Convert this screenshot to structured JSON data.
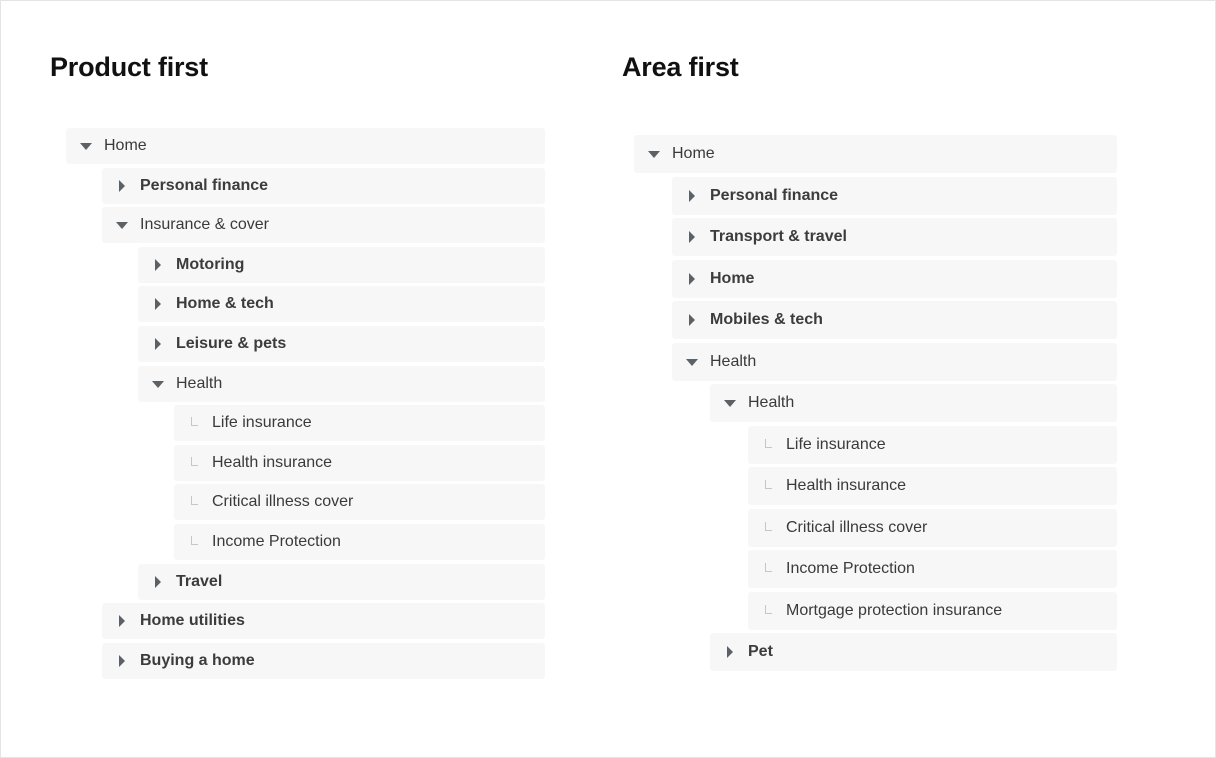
{
  "panels": [
    {
      "title": "Product first",
      "rows": [
        {
          "label": "Home",
          "level": 0,
          "state": "expanded",
          "bold": false
        },
        {
          "label": "Personal finance",
          "level": 1,
          "state": "collapsed",
          "bold": true
        },
        {
          "label": "Insurance & cover",
          "level": 1,
          "state": "expanded",
          "bold": false
        },
        {
          "label": "Motoring",
          "level": 2,
          "state": "collapsed",
          "bold": true
        },
        {
          "label": "Home & tech",
          "level": 2,
          "state": "collapsed",
          "bold": true
        },
        {
          "label": "Leisure & pets",
          "level": 2,
          "state": "collapsed",
          "bold": true
        },
        {
          "label": "Health",
          "level": 2,
          "state": "expanded",
          "bold": false
        },
        {
          "label": "Life insurance",
          "level": 3,
          "state": "leaf",
          "bold": false
        },
        {
          "label": "Health insurance",
          "level": 3,
          "state": "leaf",
          "bold": false
        },
        {
          "label": "Critical illness cover",
          "level": 3,
          "state": "leaf",
          "bold": false
        },
        {
          "label": "Income Protection",
          "level": 3,
          "state": "leaf",
          "bold": false
        },
        {
          "label": "Travel",
          "level": 2,
          "state": "collapsed",
          "bold": true
        },
        {
          "label": "Home utilities",
          "level": 1,
          "state": "collapsed",
          "bold": true
        },
        {
          "label": "Buying a home",
          "level": 1,
          "state": "collapsed",
          "bold": true
        }
      ]
    },
    {
      "title": "Area first",
      "rows": [
        {
          "label": "Home",
          "level": 0,
          "state": "expanded",
          "bold": false
        },
        {
          "label": "Personal finance",
          "level": 1,
          "state": "collapsed",
          "bold": true
        },
        {
          "label": "Transport & travel",
          "level": 1,
          "state": "collapsed",
          "bold": true
        },
        {
          "label": "Home",
          "level": 1,
          "state": "collapsed",
          "bold": true
        },
        {
          "label": "Mobiles & tech",
          "level": 1,
          "state": "collapsed",
          "bold": true
        },
        {
          "label": "Health",
          "level": 1,
          "state": "expanded",
          "bold": false
        },
        {
          "label": "Health",
          "level": 2,
          "state": "expanded",
          "bold": false
        },
        {
          "label": "Life insurance",
          "level": 3,
          "state": "leaf",
          "bold": false
        },
        {
          "label": "Health insurance",
          "level": 3,
          "state": "leaf",
          "bold": false
        },
        {
          "label": "Critical illness cover",
          "level": 3,
          "state": "leaf",
          "bold": false
        },
        {
          "label": "Income Protection",
          "level": 3,
          "state": "leaf",
          "bold": false
        },
        {
          "label": "Mortgage protection insurance",
          "level": 3,
          "state": "leaf",
          "bold": false
        },
        {
          "label": "Pet",
          "level": 2,
          "state": "collapsed",
          "bold": true
        }
      ]
    }
  ]
}
